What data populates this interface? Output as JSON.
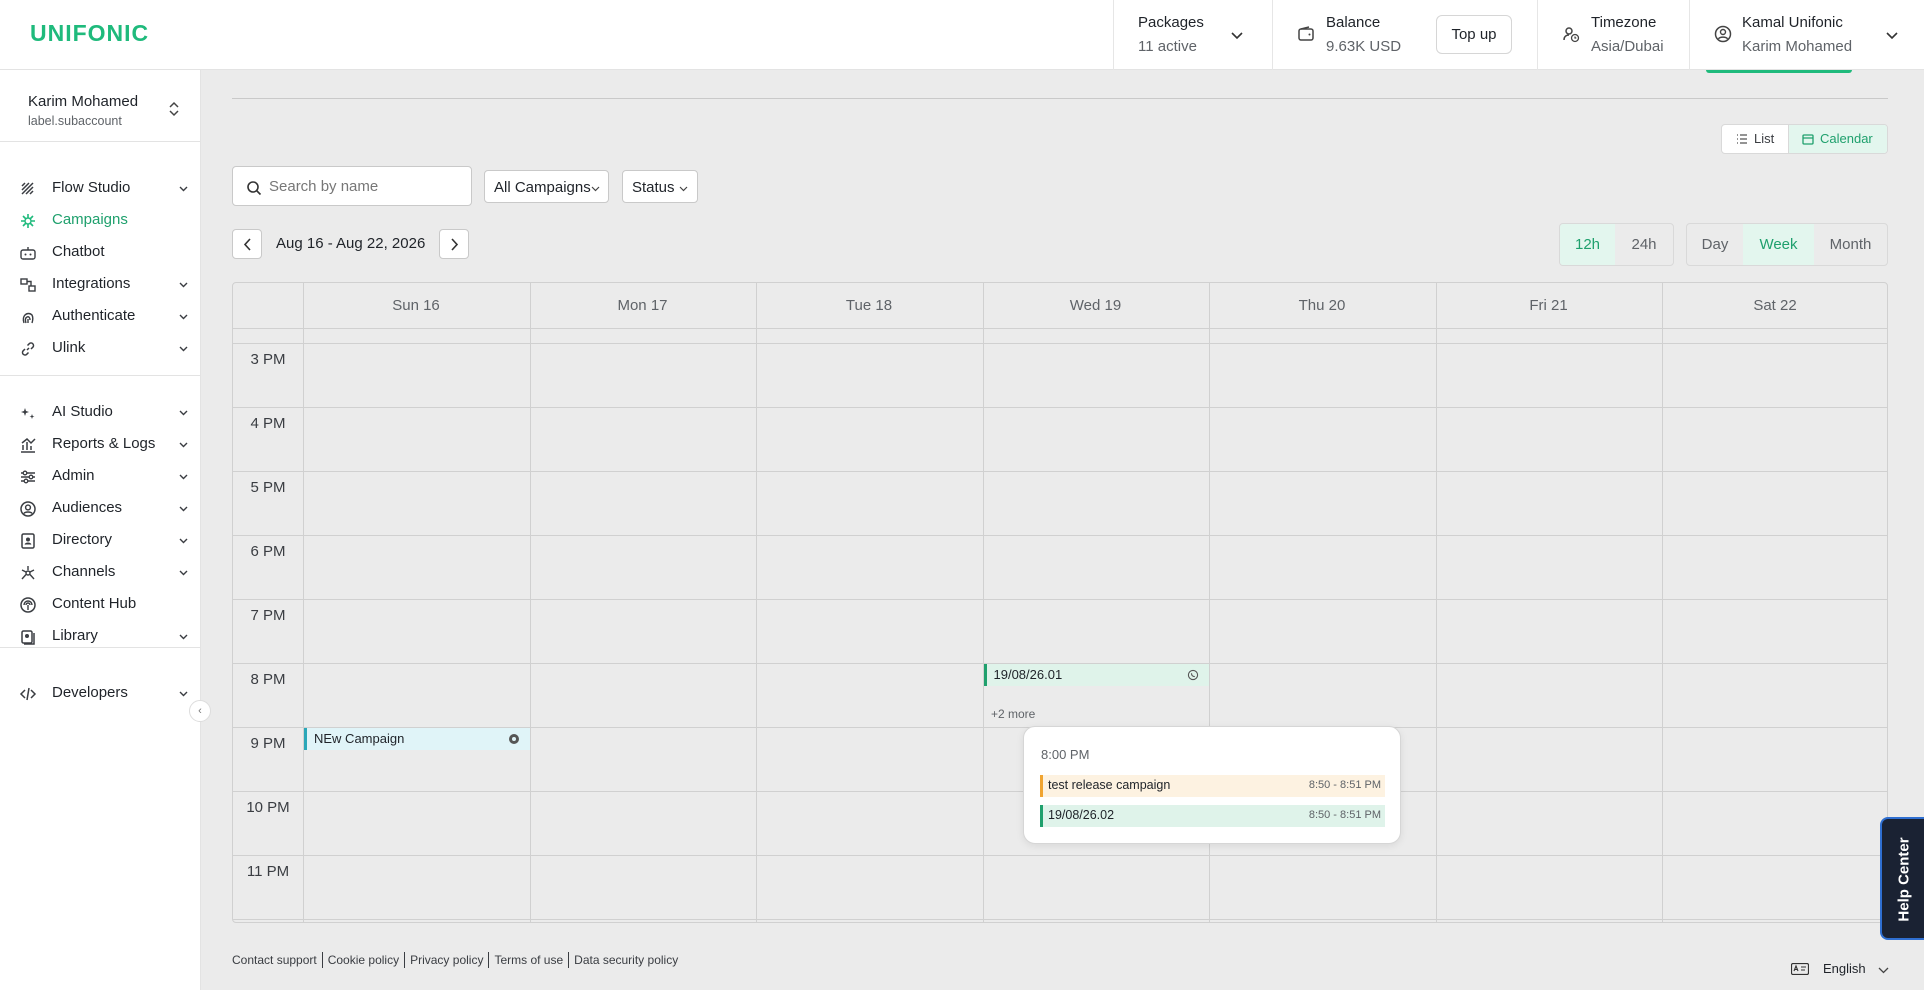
{
  "header": {
    "logo": "UNIFONIC",
    "packages": {
      "title": "Packages",
      "sub": "11 active"
    },
    "balance": {
      "title": "Balance",
      "sub": "9.63K USD",
      "topup": "Top up"
    },
    "timezone": {
      "title": "Timezone",
      "sub": "Asia/Dubai"
    },
    "user": {
      "title": "Kamal Unifonic",
      "sub": "Karim Mohamed"
    }
  },
  "sidebar": {
    "account": {
      "name": "Karim Mohamed",
      "sub": "label.subaccount"
    },
    "items": [
      {
        "label": "Flow Studio",
        "icon": "flow-studio-icon",
        "expandable": true
      },
      {
        "label": "Campaigns",
        "icon": "campaigns-icon",
        "expandable": false,
        "active": true
      },
      {
        "label": "Chatbot",
        "icon": "chatbot-icon",
        "expandable": false
      },
      {
        "label": "Integrations",
        "icon": "integrations-icon",
        "expandable": true
      },
      {
        "label": "Authenticate",
        "icon": "fingerprint-icon",
        "expandable": true
      },
      {
        "label": "Ulink",
        "icon": "link-icon",
        "expandable": true
      },
      {
        "label": "AI Studio",
        "icon": "ai-sparkle-icon",
        "expandable": true
      },
      {
        "label": "Reports & Logs",
        "icon": "reports-icon",
        "expandable": true
      },
      {
        "label": "Admin",
        "icon": "sliders-icon",
        "expandable": true
      },
      {
        "label": "Audiences",
        "icon": "user-circle-icon",
        "expandable": true
      },
      {
        "label": "Directory",
        "icon": "contact-book-icon",
        "expandable": true
      },
      {
        "label": "Channels",
        "icon": "channels-icon",
        "expandable": true
      },
      {
        "label": "Content Hub",
        "icon": "content-hub-icon",
        "expandable": false
      },
      {
        "label": "Library",
        "icon": "library-icon",
        "expandable": true
      },
      {
        "label": "Developers",
        "icon": "code-icon",
        "expandable": true
      }
    ]
  },
  "view_toggle": {
    "list": "List",
    "calendar": "Calendar",
    "selected": "Calendar"
  },
  "filters": {
    "search_placeholder": "Search by name",
    "campaigns_dropdown": "All Campaigns",
    "status_dropdown": "Status"
  },
  "calendar": {
    "range": "Aug 16 - Aug 22, 2026",
    "hour_format": {
      "options": [
        "12h",
        "24h"
      ],
      "selected": "12h"
    },
    "view": {
      "options": [
        "Day",
        "Week",
        "Month"
      ],
      "selected": "Week"
    },
    "days": [
      "Sun 16",
      "Mon 17",
      "Tue 18",
      "Wed 19",
      "Thu 20",
      "Fri 21",
      "Sat 22"
    ],
    "hours": [
      "3 PM",
      "4 PM",
      "5 PM",
      "6 PM",
      "7 PM",
      "8 PM",
      "9 PM",
      "10 PM",
      "11 PM"
    ],
    "events": [
      {
        "title": "19/08/26.01",
        "day": "Wed 19",
        "hour": "8 PM",
        "icon": "whatsapp-icon",
        "color": "#1fa06d",
        "bg": "#dff3ea"
      },
      {
        "title": "NEw Campaign",
        "day": "Sun 16",
        "hour": "9 PM",
        "icon": "gear-badge-icon",
        "color": "#2aa7b8",
        "bg": "#e0f4f8"
      }
    ],
    "more_label": "+2 more",
    "popover": {
      "time": "8:00 PM",
      "events": [
        {
          "title": "test release campaign",
          "time": "8:50 - 8:51 PM",
          "color": "#f0a431",
          "bg": "#fdf2e1"
        },
        {
          "title": "19/08/26.02",
          "time": "8:50 - 8:51 PM",
          "color": "#1fa06d",
          "bg": "#dff3ea"
        }
      ]
    }
  },
  "footer": {
    "links": [
      "Contact support",
      "Cookie policy",
      "Privacy policy",
      "Terms of use",
      "Data security policy"
    ],
    "language": "English"
  },
  "help_center": "Help Center",
  "colors": {
    "accent": "#1fba7c",
    "accent_text": "#1fa06d",
    "background": "#ebebeb"
  }
}
